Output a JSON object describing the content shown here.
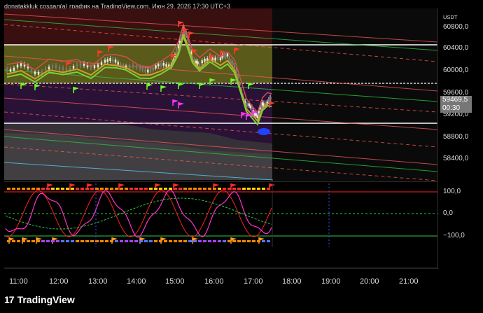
{
  "header": {
    "title": "donatakkluk создал(а) график на TradingView.com, Июн 29, 2026 17:30 UTC+3"
  },
  "currency": "USDT",
  "price_axis": [
    "60800,0",
    "60400,0",
    "60000,0",
    "59600,0",
    "59200,0",
    "58800,0",
    "58400,0"
  ],
  "current_price": {
    "value": "59469,5",
    "countdown": "00:30"
  },
  "osc_axis": [
    "100,0",
    "0,0",
    "−100,0"
  ],
  "time_axis": [
    "11:00",
    "12:00",
    "13:00",
    "14:00",
    "15:00",
    "16:00",
    "17:00",
    "18:00",
    "19:00",
    "20:00",
    "21:00"
  ],
  "brand": {
    "name": "TradingView"
  },
  "colors": {
    "background": "#000000",
    "up": "#26a69a",
    "down": "#ef5350",
    "zone_green": "#6b6a1f",
    "zone_purple": "#2a1236",
    "osc_line": "#ff33cc",
    "osc_red": "#ff2020",
    "osc_green": "#2ecc40"
  }
}
